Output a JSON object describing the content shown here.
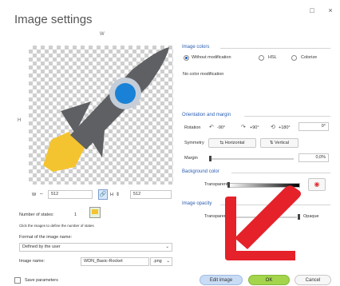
{
  "window": {
    "title": "Image settings",
    "minimize": "□",
    "close": "×"
  },
  "preview": {
    "width_label": "W",
    "height_label": "H"
  },
  "size": {
    "w_label": "W",
    "w_value": "512",
    "h_label": "H",
    "h_value": "512"
  },
  "states": {
    "label": "Number of states:",
    "value": "1",
    "hint": "Click the images to define the number of states"
  },
  "format": {
    "label": "Format of the image name:",
    "value": "Defined by the user"
  },
  "image_name": {
    "label": "Image name:",
    "value": "WDN_Basic-Rocket",
    "ext": ".png"
  },
  "colors": {
    "section": "Image colors",
    "options": [
      "Without modification",
      "HSL",
      "Colorize"
    ],
    "selected": 0,
    "status": "No color modification"
  },
  "orientation": {
    "section": "Orientation and margin",
    "rotation_label": "Rotation",
    "rot_neg90": "-90°",
    "rot_pos90": "+90°",
    "rot_180": "+180°",
    "rotation_value": "0°",
    "symmetry_label": "Symmetry",
    "horizontal": "Horizontal",
    "vertical": "Vertical",
    "margin_label": "Margin",
    "margin_value": "0,0%"
  },
  "background": {
    "section": "Background color",
    "transparent": "Transparent"
  },
  "opacity": {
    "section": "Image opacity",
    "transparent": "Transparent",
    "opaque": "Opaque"
  },
  "footer": {
    "save_params": "Save parameters",
    "edit": "Edit image",
    "ok": "OK",
    "cancel": "Cancel"
  },
  "colors_palette": {
    "accent": "#2a5db0",
    "ok": "#a3d44b",
    "edit": "#c9dcf5",
    "arrow": "#e5212a",
    "rocket": "#5f6063",
    "flame": "#f4c430",
    "porthole": "#1a82d6"
  }
}
